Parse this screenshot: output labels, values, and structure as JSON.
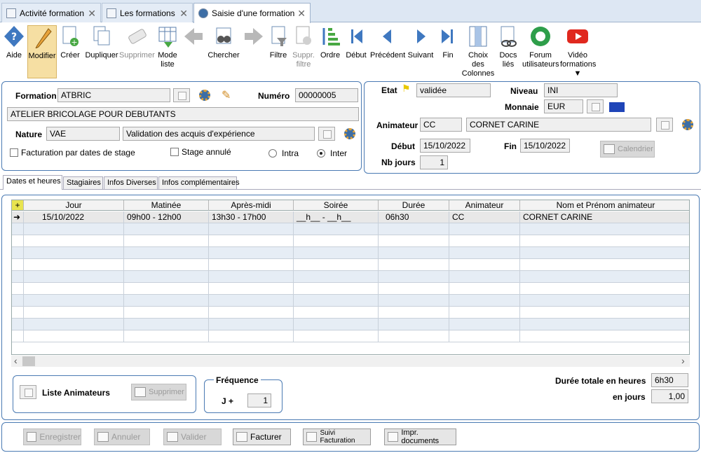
{
  "tabs": [
    {
      "label": "Activité formation",
      "close": "✕"
    },
    {
      "label": "Les formations",
      "close": "✕"
    },
    {
      "label": "Saisie d'une formation",
      "close": "✕"
    }
  ],
  "toolbar": {
    "aide": "Aide",
    "modifier": "Modifier",
    "creer": "Créer",
    "dupliquer": "Dupliquer",
    "supprimer": "Supprimer",
    "mode_liste_1": "Mode",
    "mode_liste_2": "liste",
    "chercher": "Chercher",
    "filtre": "Filtre",
    "suppr_filtre_1": "Suppr.",
    "suppr_filtre_2": "filtre",
    "ordre": "Ordre",
    "debut": "Début",
    "precedent": "Précédent",
    "suivant": "Suivant",
    "fin": "Fin",
    "choix_1": "Choix",
    "choix_2": "des",
    "choix_3": "Colonnes",
    "docs_1": "Docs",
    "docs_2": "liés",
    "forum_1": "Forum",
    "forum_2": "utilisateurs",
    "video_1": "Vidéo",
    "video_2": "formations"
  },
  "form": {
    "formation_label": "Formation",
    "formation_code": "ATBRIC",
    "numero_label": "Numéro",
    "numero": "00000005",
    "titre": "ATELIER BRICOLAGE POUR DEBUTANTS",
    "nature_label": "Nature",
    "nature_code": "VAE",
    "nature_desc": "Validation des acquis d'expérience",
    "fact_dates": "Facturation par dates de stage",
    "stage_annule": "Stage annulé",
    "intra": "Intra",
    "inter": "Inter",
    "etat_label": "Etat",
    "etat": "validée",
    "niveau_label": "Niveau",
    "niveau": "INI",
    "monnaie_label": "Monnaie",
    "monnaie": "EUR",
    "animateur_label": "Animateur",
    "animateur_code": "CC",
    "animateur_nom": "CORNET CARINE",
    "debut_label": "Début",
    "debut": "15/10/2022",
    "fin_label": "Fin",
    "fin": "15/10/2022",
    "calendrier": "Calendrier",
    "nbjours_label": "Nb jours",
    "nbjours": "1"
  },
  "subtabs": [
    "Dates et heures",
    "Stagiaires",
    "Infos Diverses",
    "Infos complémentaires"
  ],
  "grid": {
    "headers": [
      "Jour",
      "Matinée",
      "Après-midi",
      "Soirée",
      "Durée",
      "Animateur",
      "Nom et Prénom animateur"
    ],
    "rows": [
      [
        "15/10/2022",
        "09h00 - 12h00",
        "13h30 - 17h00",
        "__h__ - __h__",
        "06h30",
        "CC",
        "CORNET CARINE"
      ]
    ],
    "add_icon": "+",
    "row_marker": "➜",
    "scroll_left": "‹",
    "scroll_right": "›"
  },
  "bottom": {
    "liste_animateurs": "Liste Animateurs",
    "supprimer": "Supprimer",
    "frequence": "Fréquence",
    "j_plus": "J +",
    "freq_val": "1",
    "duree_label": "Durée totale en heures",
    "duree": "6h30",
    "enjours_label": "en jours",
    "enjours": "1,00"
  },
  "actions": {
    "enregistrer": "Enregistrer",
    "annuler": "Annuler",
    "valider": "Valider",
    "facturer": "Facturer",
    "suivi": "Suivi Facturation",
    "impr": "Impr. documents"
  },
  "colors": {
    "accent": "#4a7ab3",
    "selected": "#f6dfa3"
  }
}
